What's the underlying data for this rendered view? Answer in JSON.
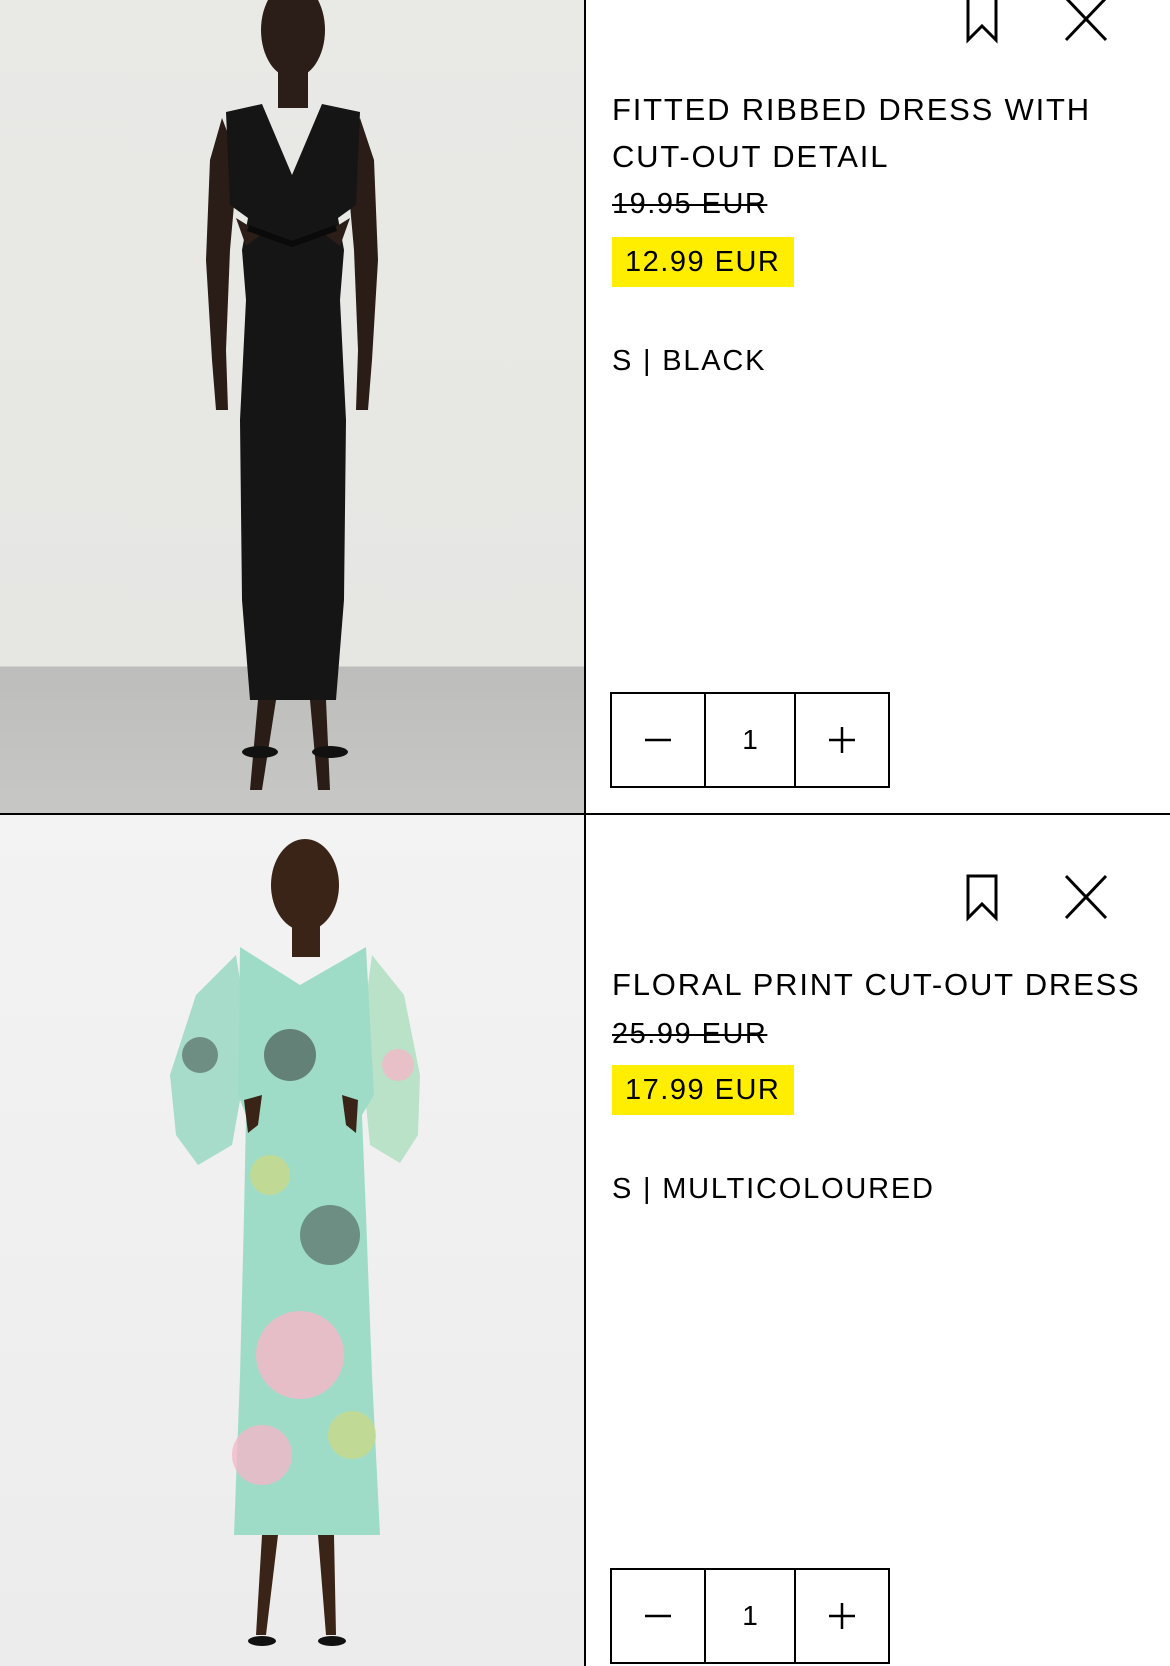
{
  "items": [
    {
      "title": "FITTED RIBBED DRESS WITH CUT-OUT DETAIL",
      "old_price": "19.95 EUR",
      "new_price": "12.99 EUR",
      "variant": "S | BLACK",
      "quantity": "1",
      "image": "black-ribbed-cutout-dress-model-photo"
    },
    {
      "title": "FLORAL PRINT CUT-OUT DRESS",
      "old_price": "25.99 EUR",
      "new_price": "17.99 EUR",
      "variant": "S | MULTICOLOURED",
      "quantity": "1",
      "image": "floral-cutout-dress-model-photo"
    }
  ],
  "icons": {
    "save": "bookmark-icon",
    "remove": "close-icon",
    "decrease": "minus-icon",
    "increase": "plus-icon"
  },
  "colors": {
    "sale_highlight": "#ffee00",
    "text": "#000000",
    "floral_green": "#8fd9c4",
    "floral_pink": "#f2b8c8"
  }
}
